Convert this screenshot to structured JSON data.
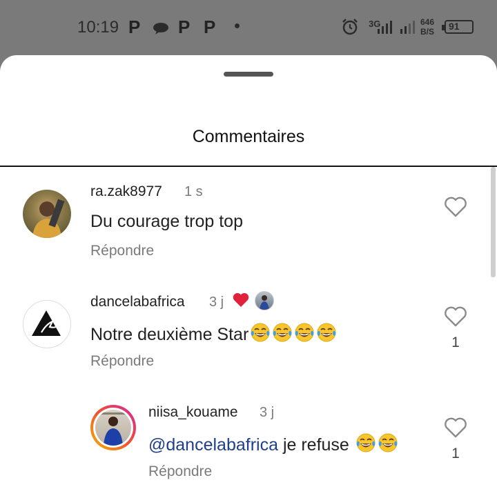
{
  "status_bar": {
    "time": "10:19",
    "notif_icons": [
      "P",
      "chat-bubble",
      "P",
      "P"
    ],
    "network": "3G",
    "speed_value": "646",
    "speed_unit": "B/S",
    "battery": "91"
  },
  "sheet": {
    "title": "Commentaires"
  },
  "comments": [
    {
      "username": "ra.zak8977",
      "time": "1 s",
      "text": "Du courage trop top",
      "reply_label": "Répondre",
      "likes": ""
    },
    {
      "username": "dancelabafrica",
      "time": "3 j",
      "text": "Notre deuxième Star",
      "emoji_count": 4,
      "reply_label": "Répondre",
      "likes": "1"
    },
    {
      "username": "niisa_kouame",
      "time": "3 j",
      "mention": "@dancelabafrica",
      "text": " je refuse ",
      "emoji_count": 2,
      "reply_label": "Répondre",
      "likes": "1"
    }
  ],
  "colors": {
    "mention": "#1f3f8a",
    "like_heart": "#e0223a",
    "story_ring_start": "#f5b400",
    "story_ring_end": "#d6249f"
  }
}
